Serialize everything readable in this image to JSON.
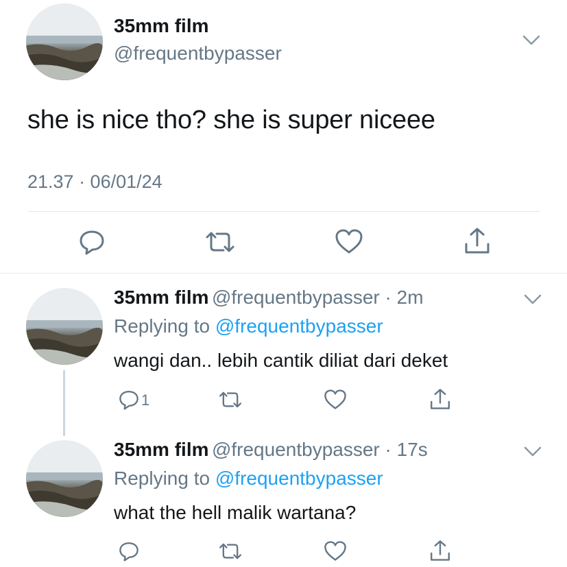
{
  "main_tweet": {
    "author_name": "35mm film",
    "handle": "@frequentbypasser",
    "text": "she is nice tho? she is super niceee",
    "timestamp": "21.37 · 06/01/24",
    "actions": [
      "reply-icon",
      "retweet-icon",
      "like-icon",
      "share-icon"
    ],
    "menu_icon": "chevron-down-icon"
  },
  "replies": [
    {
      "author_name": "35mm film",
      "handle_time": "@frequentbypasser · 2m",
      "replying_prefix": "Replying to",
      "replying_to": "@frequentbypasser",
      "text": "wangi dan.. lebih cantik diliat dari deket",
      "reply_count": "1"
    },
    {
      "author_name": "35mm film",
      "handle_time": "@frequentbypasser · 17s",
      "replying_prefix": "Replying to",
      "replying_to": "@frequentbypasser",
      "text": "what the hell malik wartana?",
      "reply_count": ""
    }
  ],
  "colors": {
    "text": "#14171a",
    "secondary": "#657786",
    "link": "#1da1f2",
    "divider": "#e1e8ed",
    "thread_line": "#ccd6dd"
  }
}
